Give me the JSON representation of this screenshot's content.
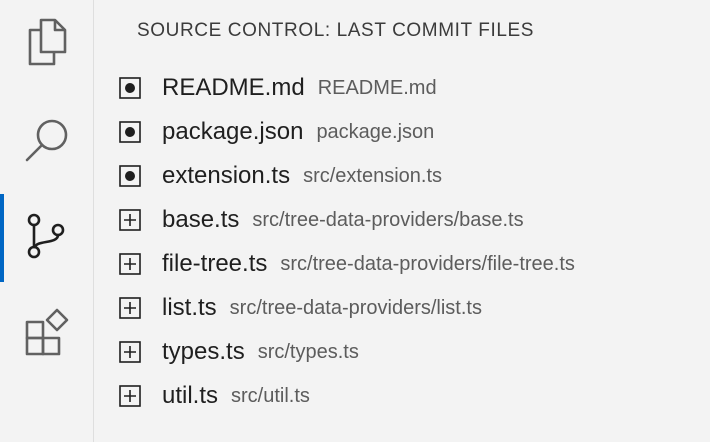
{
  "activity_bar": {
    "items": [
      {
        "name": "explorer",
        "icon": "files-icon",
        "active": false
      },
      {
        "name": "search",
        "icon": "search-icon",
        "active": true
      },
      {
        "name": "source-control",
        "icon": "source-control-icon",
        "active": true
      },
      {
        "name": "extensions",
        "icon": "extensions-icon",
        "active": false
      }
    ],
    "accent_color": "#0066c4"
  },
  "panel": {
    "title": "SOURCE CONTROL: LAST COMMIT FILES"
  },
  "files": [
    {
      "name": "README.md",
      "description": "README.md",
      "status": "modified",
      "status_icon": "modified-dot-icon"
    },
    {
      "name": "package.json",
      "description": "package.json",
      "status": "modified",
      "status_icon": "modified-dot-icon"
    },
    {
      "name": "extension.ts",
      "description": "src/extension.ts",
      "status": "modified",
      "status_icon": "modified-dot-icon"
    },
    {
      "name": "base.ts",
      "description": "src/tree-data-providers/base.ts",
      "status": "added",
      "status_icon": "added-plus-icon"
    },
    {
      "name": "file-tree.ts",
      "description": "src/tree-data-providers/file-tree.ts",
      "status": "added",
      "status_icon": "added-plus-icon"
    },
    {
      "name": "list.ts",
      "description": "src/tree-data-providers/list.ts",
      "status": "added",
      "status_icon": "added-plus-icon"
    },
    {
      "name": "types.ts",
      "description": "src/types.ts",
      "status": "added",
      "status_icon": "added-plus-icon"
    },
    {
      "name": "util.ts",
      "description": "src/util.ts",
      "status": "added",
      "status_icon": "added-plus-icon"
    }
  ]
}
